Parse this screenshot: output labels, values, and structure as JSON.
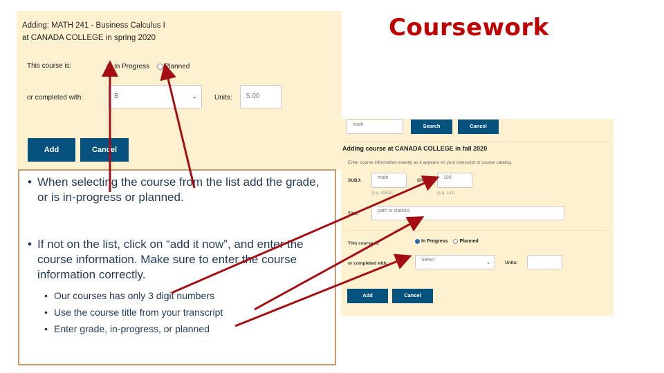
{
  "slide": {
    "title": "Coursework"
  },
  "left_form": {
    "heading_line1": "Adding: MATH 241 - Business Calculus I",
    "heading_line2": "at CANADA COLLEGE in spring 2020",
    "status_label": "This course is:",
    "radio_options": [
      {
        "label": "In Progress",
        "checked": false
      },
      {
        "label": "Planned",
        "checked": false
      }
    ],
    "grade_label": "or completed with:",
    "grade_value": "B",
    "units_label": "Units:",
    "units_value": "5.00",
    "add_label": "Add",
    "cancel_label": "Cancel"
  },
  "right_form": {
    "search_value": "math",
    "search_label": "Search",
    "search_cancel_label": "Cancel",
    "heading": "Adding course at CANADA COLLEGE in fall 2020",
    "instructions": "Enter course information exactly as it appears on your transcript or course catalog.",
    "subj_label": "SUBJ:",
    "subj_value": "math",
    "subj_hint": "(e.g. GEOL)",
    "crs_label": "CRS#:",
    "crs_value": "100",
    "crs_hint": "(e.g. 101)",
    "title_label": "Title:",
    "title_value": "path to statistic",
    "status_label": "This course is:",
    "radio_options": [
      {
        "label": "In Progress",
        "checked": true
      },
      {
        "label": "Planned",
        "checked": false
      }
    ],
    "grade_label": "or completed with:",
    "grade_placeholder": "Select",
    "units_label": "Units:",
    "units_value": "",
    "add_label": "Add",
    "cancel_label": "Cancel"
  },
  "instructions_box": {
    "bullets": [
      "When selecting the course from the list add the grade, or is in-progress or planned.",
      "If not on the list, click on “add it now”, and enter the course information.  Make sure to enter the course information correctly."
    ],
    "sub_bullets": [
      "Our courses has only 3 digit numbers",
      "Use  the course title from your transcript",
      "Enter grade, in-progress, or planned"
    ],
    "bullet_char": "•"
  },
  "colors": {
    "title": "#c00000",
    "panel_bg": "#fdf1cf",
    "button": "#05527f",
    "arrow": "#a50f14",
    "body_text": "#1f3a5a",
    "box_border": "#c89a6c"
  }
}
